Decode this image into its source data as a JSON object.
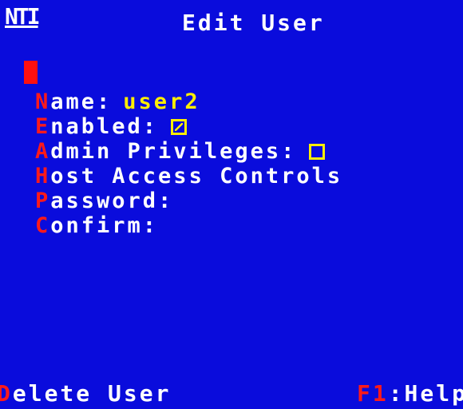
{
  "header": {
    "logo_text": "NTI",
    "title": "Edit User"
  },
  "colors": {
    "background": "#0a0cdc",
    "text": "#ffffff",
    "hotkey": "#ff1a1a",
    "value": "#ffee00"
  },
  "menu": {
    "name": {
      "hotkey": "N",
      "rest": "ame:",
      "value": "user2"
    },
    "enabled": {
      "hotkey": "E",
      "rest": "nabled:",
      "checked": true
    },
    "admin": {
      "hotkey": "A",
      "rest": "dmin Privileges:",
      "checked": false
    },
    "host": {
      "hotkey": "H",
      "rest": "ost Access Controls"
    },
    "password": {
      "hotkey": "P",
      "rest": "assword:"
    },
    "confirm": {
      "hotkey": "C",
      "rest": "onfirm:"
    }
  },
  "footer": {
    "delete": {
      "hotkey": "D",
      "rest": "elete User"
    },
    "help": {
      "hotkey": "F1",
      "rest": ":Help"
    }
  }
}
